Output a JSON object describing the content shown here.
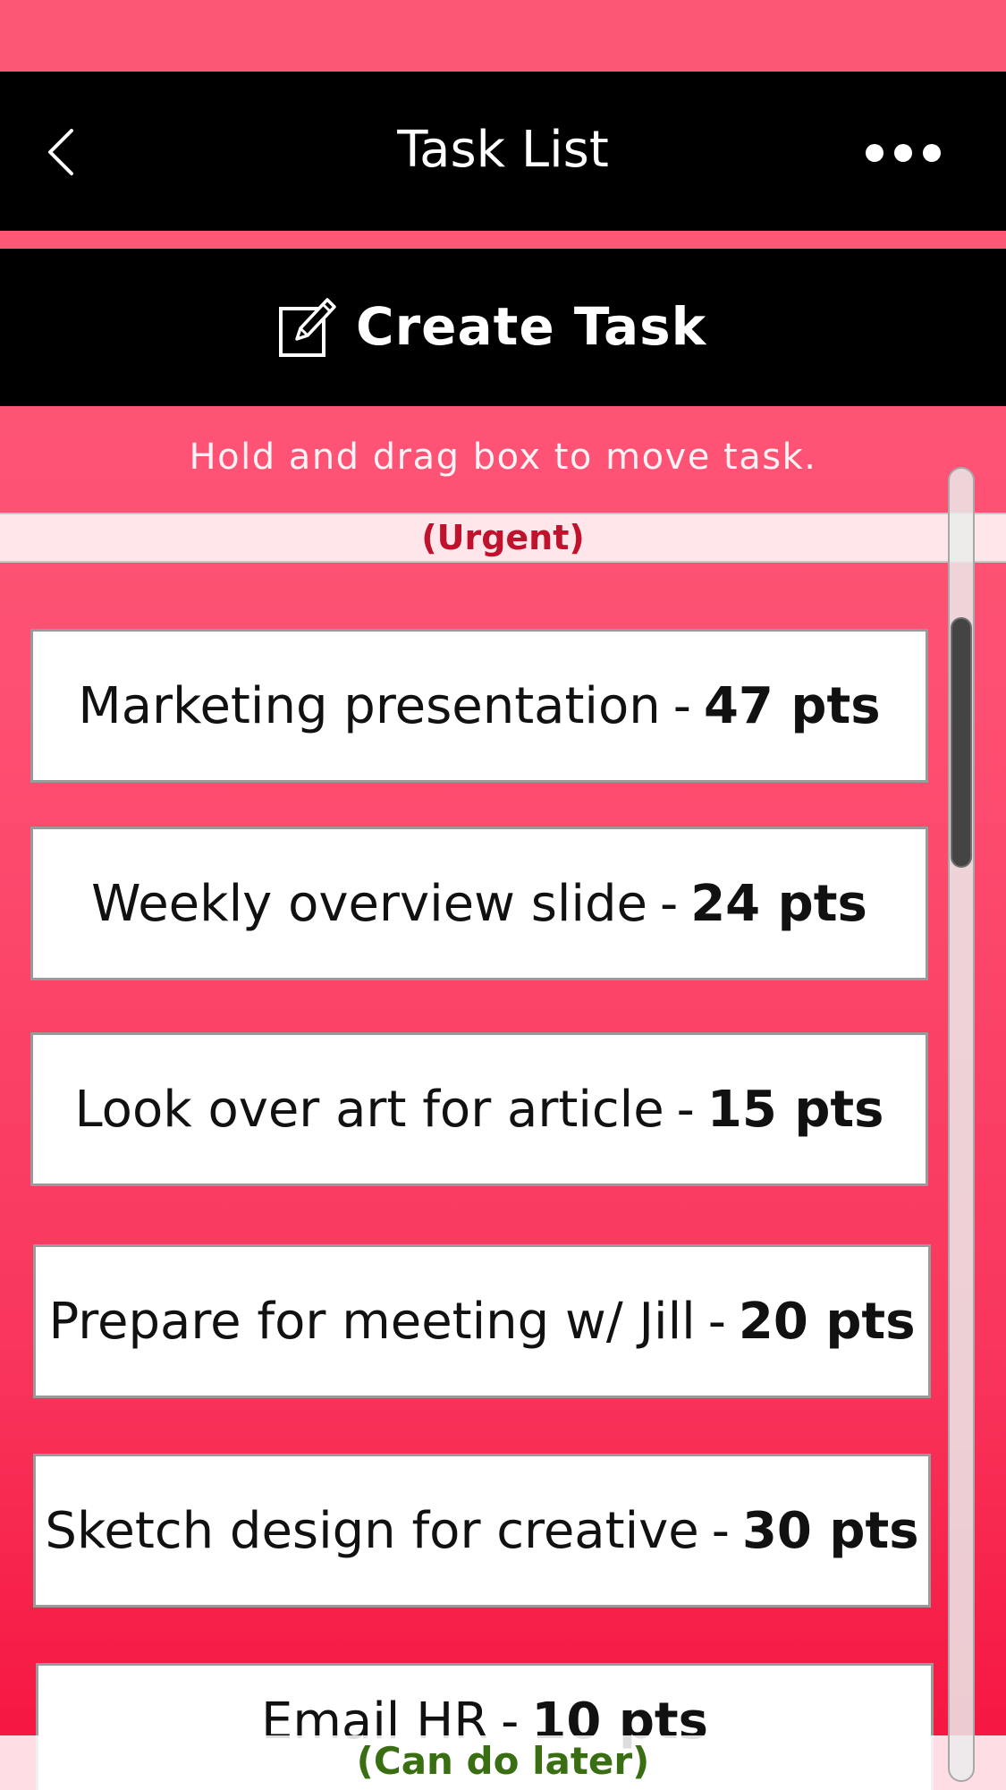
{
  "header": {
    "title": "Task List",
    "back_icon": "chevron-left-icon",
    "more_icon": "ellipsis-icon"
  },
  "create_task": {
    "label": "Create Task",
    "icon": "edit-pencil-icon"
  },
  "hint": "Hold and drag box to move task.",
  "sections": {
    "urgent_label": "(Urgent)",
    "later_label": "(Can do later)"
  },
  "tasks": [
    {
      "name": "Marketing presentation",
      "separator": "-",
      "points": "47 pts"
    },
    {
      "name": "Weekly overview slide",
      "separator": "-",
      "points": "24 pts"
    },
    {
      "name": "Look over art for article",
      "separator": "-",
      "points": "15 pts"
    },
    {
      "name": "Prepare for meeting w/ Jill",
      "separator": "-",
      "points": "20 pts"
    },
    {
      "name": "Sketch design for creative",
      "separator": "-",
      "points": "30 pts"
    },
    {
      "name": "Email HR",
      "separator": "-",
      "points": "10 pts"
    }
  ],
  "colors": {
    "accent": "#fc5775",
    "bar": "#000000",
    "urgent_text": "#c0112d",
    "later_text": "#3a6e12"
  }
}
